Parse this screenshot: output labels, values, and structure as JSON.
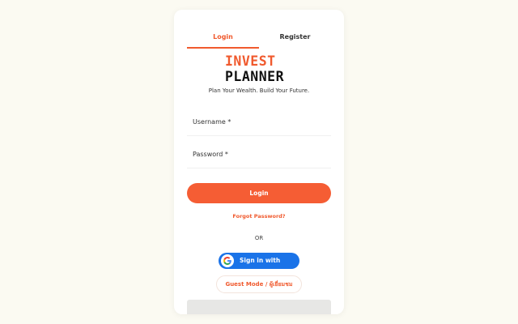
{
  "tabs": {
    "login": "Login",
    "register": "Register"
  },
  "logo": {
    "line1": "INVEST",
    "line2": "PLANNER"
  },
  "tagline": "Plan Your Wealth. Build Your Future.",
  "form": {
    "username_label": "Username *",
    "password_label": "Password *",
    "login_button": "Login",
    "forgot_password": "Forgot Password?"
  },
  "divider": "OR",
  "google": {
    "label": "Sign in with Google",
    "icon": "google-g-icon"
  },
  "guest": {
    "label": "Guest Mode / ผู้เยี่ยมชม"
  },
  "colors": {
    "accent": "#f55d34",
    "google_blue": "#1a73e8",
    "background": "#fbfaf2"
  }
}
